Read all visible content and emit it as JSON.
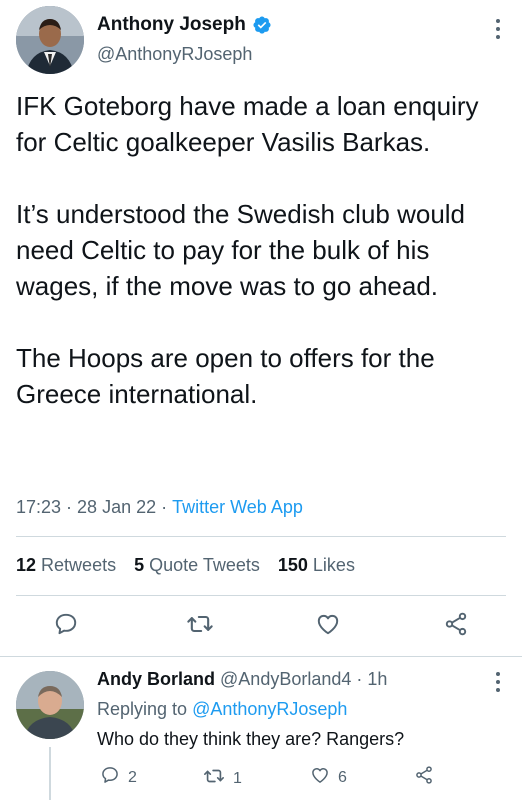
{
  "tweet": {
    "author_name": "Anthony Joseph",
    "author_handle": "@AnthonyRJoseph",
    "paragraphs": [
      "IFK Goteborg have made a loan enquiry for Celtic goalkeeper Vasilis Barkas.",
      "It’s understood the Swedish club would need Celtic to pay for the bulk of his wages, if the move was to go ahead.",
      "The Hoops are open to offers for the Greece international."
    ],
    "time": "17:23",
    "date": "28 Jan 22",
    "app": "Twitter Web App",
    "separator": " · ",
    "stats": {
      "retweets_count": "12",
      "retweets_label": "Retweets",
      "quote_count": "5",
      "quote_label": "Quote Tweets",
      "likes_count": "150",
      "likes_label": "Likes"
    }
  },
  "reply": {
    "author_name": "Andy Borland",
    "author_handle": "@AndyBorland4",
    "time": "· 1h",
    "replying_prefix": "Replying to",
    "replying_to": "@AnthonyRJoseph",
    "text": "Who do they think they are? Rangers?",
    "reply_count": "2",
    "retweet_count": "1",
    "like_count": "6"
  },
  "colors": {
    "accent": "#1d9bf0",
    "secondary_text": "#536471",
    "primary_text": "#0f1419",
    "border": "#cfd9de"
  },
  "icons": [
    "verified-badge-icon",
    "more-icon",
    "reply-icon",
    "retweet-icon",
    "like-icon",
    "share-icon"
  ]
}
